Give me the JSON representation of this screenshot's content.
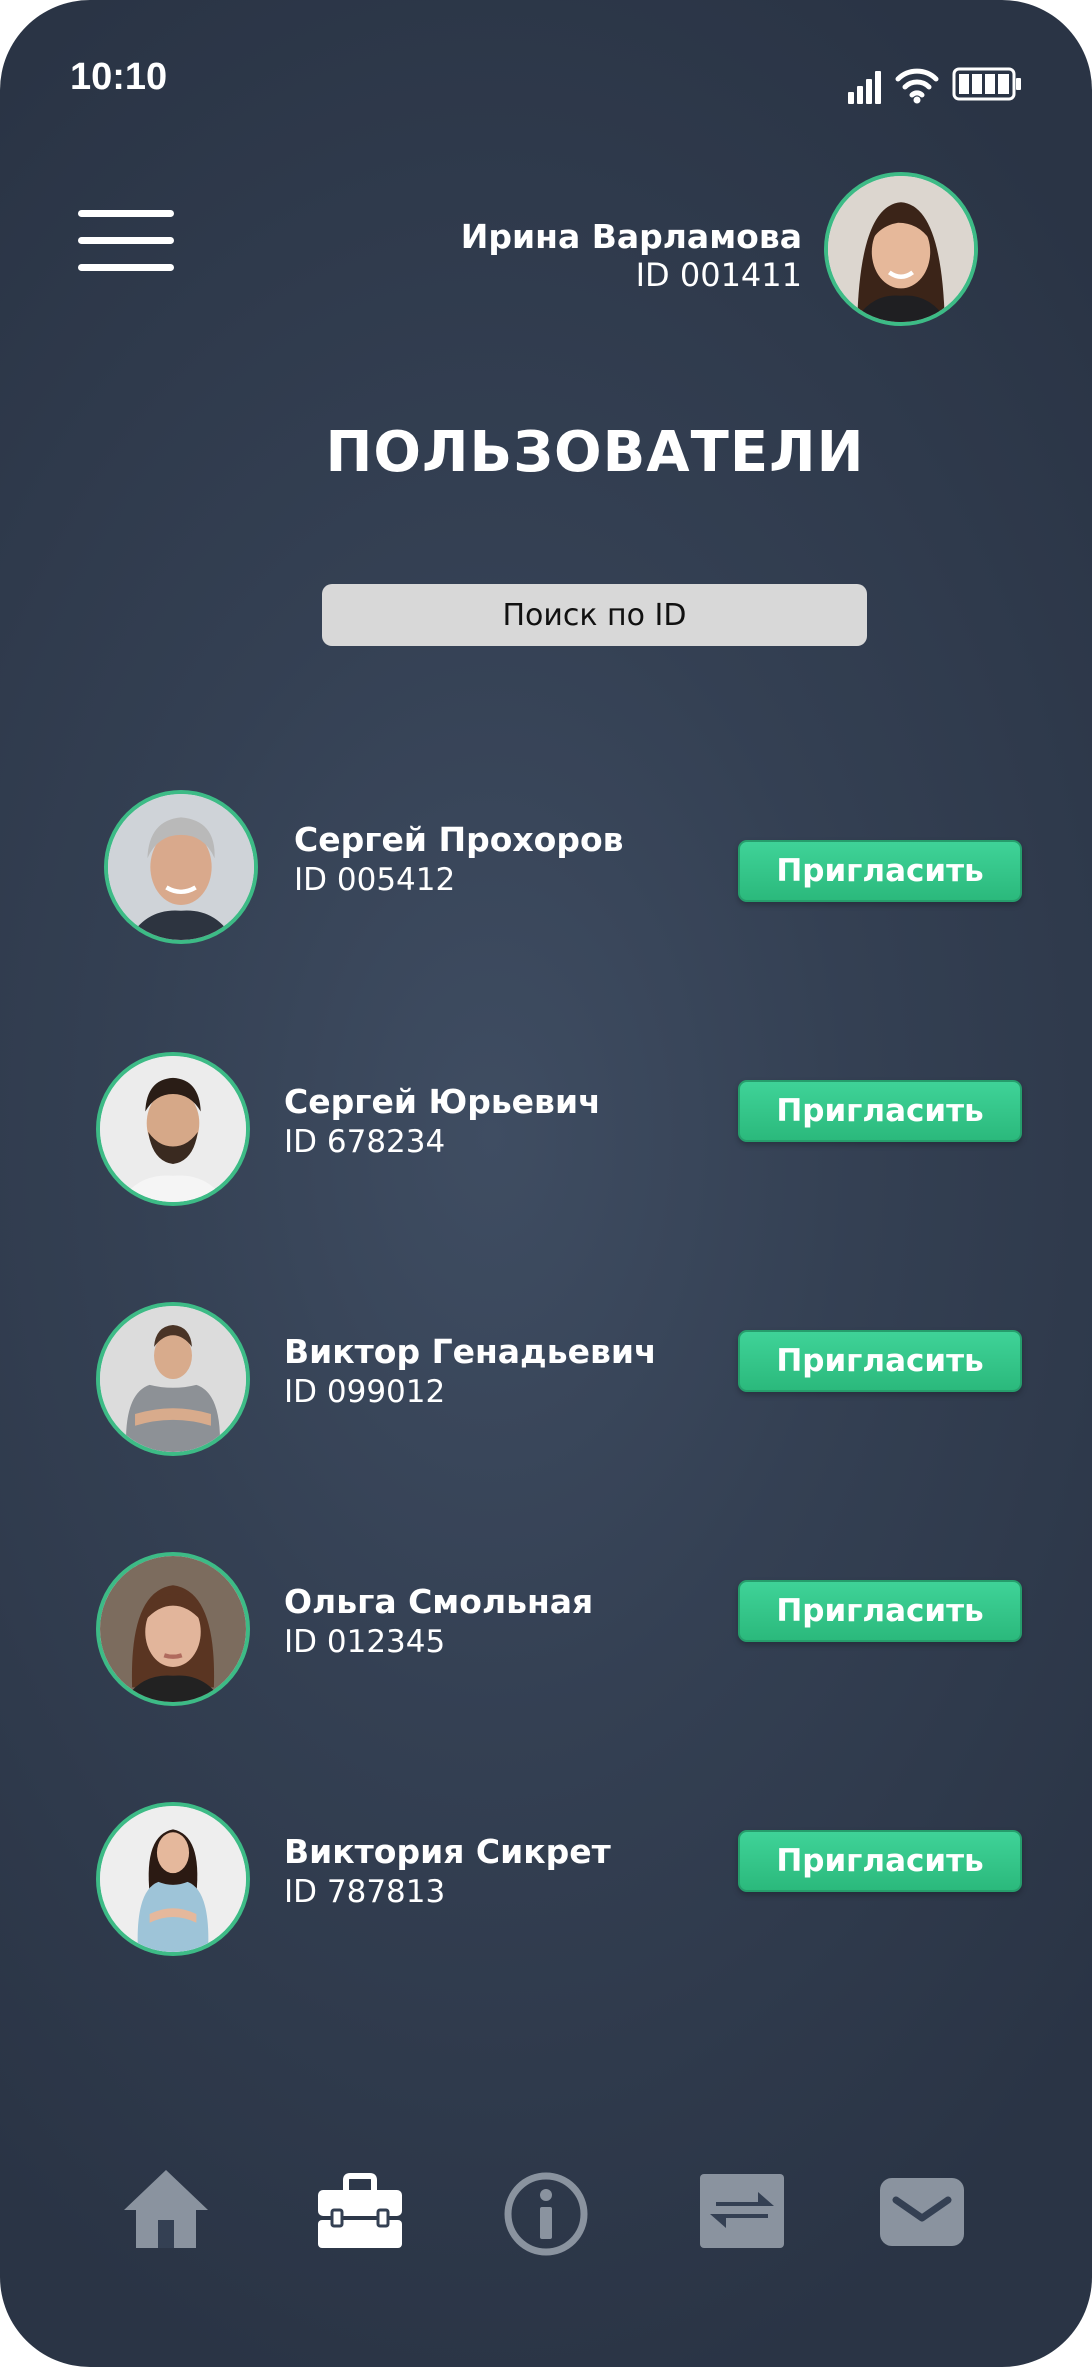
{
  "status_bar": {
    "time": "10:10"
  },
  "header": {
    "current_user": {
      "name": "Ирина Варламова",
      "id": "ID 001411"
    }
  },
  "page": {
    "title": "ПОЛЬЗОВАТЕЛИ"
  },
  "search": {
    "placeholder": "Поиск по ID"
  },
  "users": [
    {
      "name": "Сергей Прохоров",
      "id": "ID 005412",
      "action": "Пригласить"
    },
    {
      "name": "Сергей Юрьевич",
      "id": "ID 678234",
      "action": "Пригласить"
    },
    {
      "name": "Виктор Генадьевич",
      "id": "ID 099012",
      "action": "Пригласить"
    },
    {
      "name": "Ольга Смольная",
      "id": "ID 012345",
      "action": "Пригласить"
    },
    {
      "name": "Виктория Сикрет",
      "id": "ID 787813",
      "action": "Пригласить"
    }
  ],
  "bottom_nav": [
    {
      "icon": "home-icon"
    },
    {
      "icon": "briefcase-icon"
    },
    {
      "icon": "info-icon"
    },
    {
      "icon": "transfer-icon"
    },
    {
      "icon": "mail-icon"
    }
  ],
  "colors": {
    "accent_green": "#2fc485",
    "background": "#344053",
    "nav_inactive": "#8a939f",
    "nav_active": "#ffffff"
  }
}
